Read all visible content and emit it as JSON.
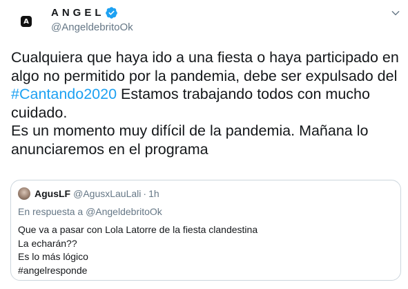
{
  "author": {
    "display_name": "ANGEL",
    "handle": "@AngeldebritoOk",
    "avatar_letter": "A",
    "avatar_icon": "angel-logo-icon",
    "verified_icon": "verified-badge-icon",
    "menu_icon": "chevron-down-icon"
  },
  "tweet": {
    "text_before": "Cualquiera que haya ido a una fiesta o haya participado en algo no permitido por la pandemia, debe ser expulsado del ",
    "hashtag": "#Cantando2020",
    "text_after": " Estamos trabajando todos con mucho cuidado.\nEs un momento muy difícil de la pandemia. Mañana lo anunciaremos en el programa"
  },
  "quoted_tweet": {
    "name": "AgusLF",
    "handle": "@AgusxLauLali",
    "separator": "·",
    "time": "1h",
    "reply_prefix": "En respuesta a ",
    "reply_to": "@AngeldebritoOk",
    "lines": [
      "Que va a pasar con Lola Latorre de la fiesta clandestina",
      "La echarán??",
      "Es lo más lógico",
      "#angelresponde"
    ]
  },
  "colors": {
    "link": "#1da1f2",
    "secondary_text": "#657786",
    "border": "#ccd6dd"
  }
}
